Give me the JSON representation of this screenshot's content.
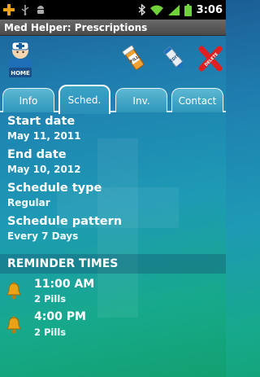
{
  "status_bar": {
    "time": "3:06",
    "icons": [
      "plus-icon",
      "usb-icon",
      "android-icon",
      "bluetooth-icon",
      "wifi-icon",
      "signal-icon",
      "battery-icon"
    ]
  },
  "app": {
    "title": "Med Helper: Prescriptions"
  },
  "toolbar": {
    "home_label": "HOME",
    "fill_label": "FILL",
    "edit_label": "EDIT",
    "delete_label": "DELETE"
  },
  "tabs": [
    {
      "label": "Info",
      "active": false
    },
    {
      "label": "Sched.",
      "active": true
    },
    {
      "label": "Inv.",
      "active": false
    },
    {
      "label": "Contact",
      "active": false
    }
  ],
  "fields": [
    {
      "label": "Start date",
      "value": "May 11, 2011"
    },
    {
      "label": "End date",
      "value": "May 10, 2012"
    },
    {
      "label": "Schedule type",
      "value": "Regular"
    },
    {
      "label": "Schedule pattern",
      "value": "Every 7 Days"
    }
  ],
  "reminders": {
    "header": "REMINDER TIMES",
    "items": [
      {
        "time": "11:00 AM",
        "quantity": "2 Pills"
      },
      {
        "time": "4:00 PM",
        "quantity": "2 Pills"
      }
    ]
  },
  "colors": {
    "accent_bell": "#e8a317",
    "delete_red": "#e02020",
    "tab_border": "#ffffff"
  }
}
